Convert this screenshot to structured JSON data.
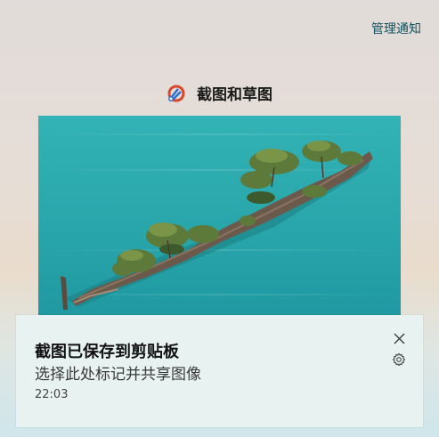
{
  "header": {
    "manage_notifications": "管理通知"
  },
  "app": {
    "name": "截图和草图",
    "icon": "snipping-tool-icon"
  },
  "preview": {
    "description_icon": "screenshot-preview"
  },
  "toast": {
    "title": "截图已保存到剪贴板",
    "body": "选择此处标记并共享图像",
    "time": "22:03",
    "close_icon": "close-icon",
    "settings_icon": "gear-icon"
  },
  "colors": {
    "link": "#10525f",
    "toast_bg": "#e8f2f1",
    "water": "#2aa6ab"
  }
}
